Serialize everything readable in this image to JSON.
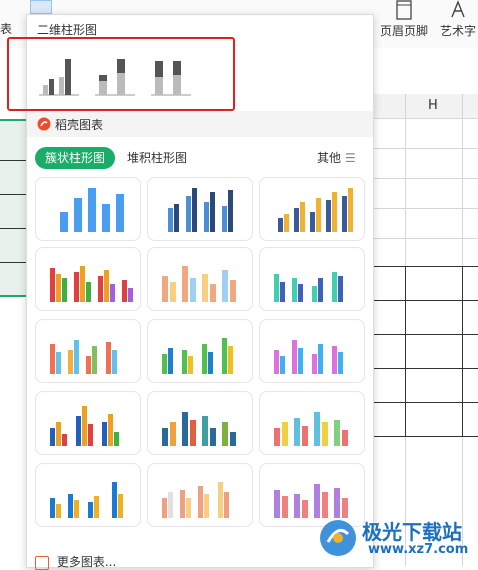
{
  "ribbon": {
    "partial_left_text": "表",
    "buttons": [
      {
        "label": "页眉页脚",
        "icon": "header-footer-icon"
      },
      {
        "label": "艺术字",
        "icon": "wordart-icon"
      }
    ]
  },
  "sheet": {
    "column_header": "H"
  },
  "panel": {
    "section_title": "二维柱形图",
    "docer_title": "稻壳图表",
    "tabs": [
      {
        "label": "簇状柱形图",
        "active": true
      },
      {
        "label": "堆积柱形图",
        "active": false
      }
    ],
    "more_tab": "其他",
    "footer": "更多图表..."
  },
  "colors": {
    "accent": "#1aad6a",
    "highlight": "#e02020",
    "bar_blue": "#4a9ef0"
  },
  "watermark": {
    "title": "极光下载站",
    "url": "www.xz7.com"
  }
}
